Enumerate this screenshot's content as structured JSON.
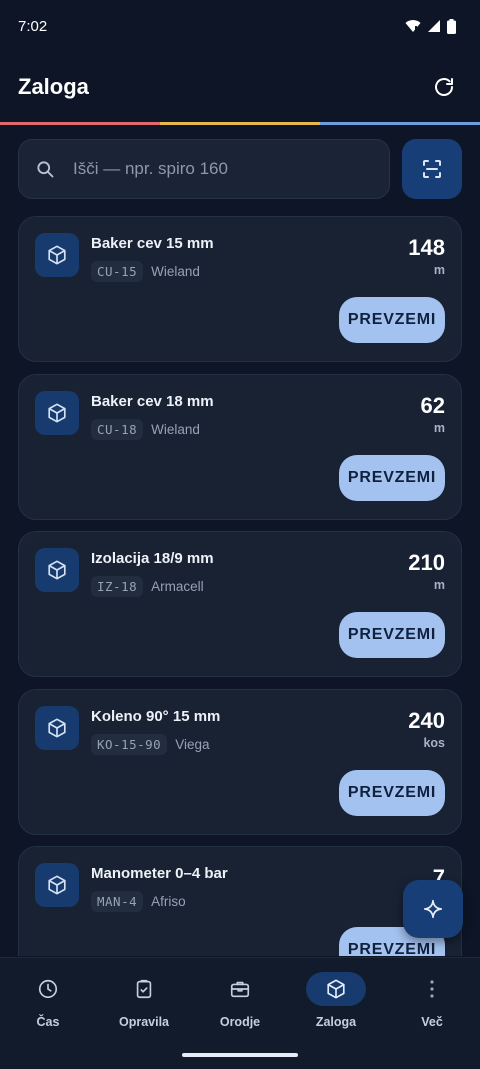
{
  "status_bar": {
    "time": "7:02"
  },
  "header": {
    "title": "Zaloga"
  },
  "accent_colors": [
    "#e06a6a",
    "#e6b74f",
    "#6b9fe0"
  ],
  "search": {
    "placeholder": "Išči — npr. spiro 160"
  },
  "items": [
    {
      "name": "Baker cev 15 mm",
      "code": "CU-15",
      "supplier": "Wieland",
      "quantity": "148",
      "unit": "m",
      "action": "PREVZEMI"
    },
    {
      "name": "Baker cev 18 mm",
      "code": "CU-18",
      "supplier": "Wieland",
      "quantity": "62",
      "unit": "m",
      "action": "PREVZEMI"
    },
    {
      "name": "Izolacija 18/9 mm",
      "code": "IZ-18",
      "supplier": "Armacell",
      "quantity": "210",
      "unit": "m",
      "action": "PREVZEMI"
    },
    {
      "name": "Koleno 90° 15 mm",
      "code": "KO-15-90",
      "supplier": "Viega",
      "quantity": "240",
      "unit": "kos",
      "action": "PREVZEMI"
    },
    {
      "name": "Manometer 0–4 bar",
      "code": "MAN-4",
      "supplier": "Afriso",
      "quantity": "7",
      "unit": "",
      "action": "PREVZEMI"
    }
  ],
  "nav": [
    {
      "label": "Čas",
      "icon": "clock-icon",
      "active": false
    },
    {
      "label": "Opravila",
      "icon": "clipboard-icon",
      "active": false
    },
    {
      "label": "Orodje",
      "icon": "toolbox-icon",
      "active": false
    },
    {
      "label": "Zaloga",
      "icon": "box-icon",
      "active": true
    },
    {
      "label": "Več",
      "icon": "more-icon",
      "active": false
    }
  ]
}
